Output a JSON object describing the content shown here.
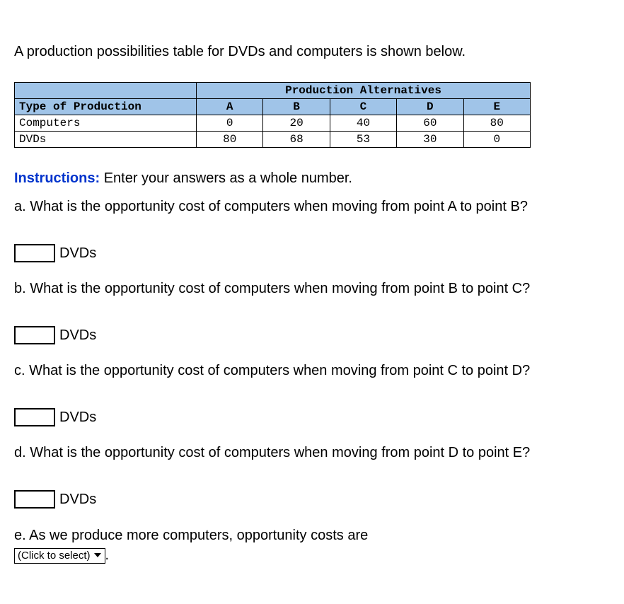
{
  "intro": "A production possibilities table for DVDs and computers is shown below.",
  "table": {
    "alt_header": "Production Alternatives",
    "row0_label": "Type of Production",
    "alts": [
      "A",
      "B",
      "C",
      "D",
      "E"
    ],
    "rows": [
      {
        "label": "Computers",
        "values": [
          "0",
          "20",
          "40",
          "60",
          "80"
        ]
      },
      {
        "label": "DVDs",
        "values": [
          "80",
          "68",
          "53",
          "30",
          "0"
        ]
      }
    ]
  },
  "instructions": {
    "label": "Instructions:",
    "text": "Enter your answers as a whole number."
  },
  "questions": {
    "a": "a. What is the opportunity cost of computers when moving from point A to point B?",
    "b": "b. What is the opportunity cost of computers when moving from point B to point C?",
    "c": "c. What is the opportunity cost of computers when moving from point C to point D?",
    "d": "d. What is the opportunity cost of computers when moving from point D to point E?",
    "e": "e. As we produce more computers, opportunity costs are"
  },
  "unit": "DVDs",
  "select_placeholder": "(Click to select)",
  "period": "."
}
